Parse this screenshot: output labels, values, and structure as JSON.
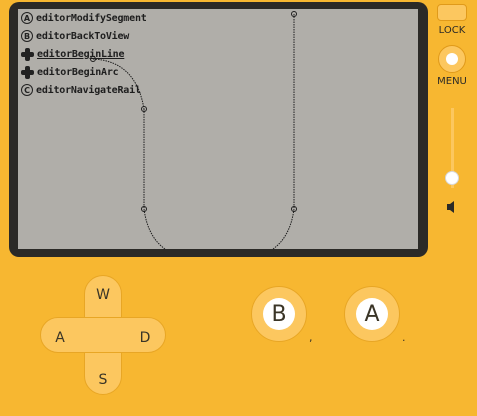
{
  "menu": {
    "items": [
      {
        "glyph": "A",
        "icon": "a-button-icon",
        "label": "editorModifySegment"
      },
      {
        "glyph": "B",
        "icon": "b-button-icon",
        "label": "editorBackToView"
      },
      {
        "glyph": "",
        "icon": "dpad-icon",
        "label": "editorBeginLine"
      },
      {
        "glyph": "",
        "icon": "dpad-icon",
        "label": "editorBeginArc"
      },
      {
        "glyph": "C",
        "icon": "crank-icon",
        "label": "editorNavigateRail"
      }
    ]
  },
  "side": {
    "lock_label": "LOCK",
    "menu_label": "MENU",
    "crank_level": 0.88
  },
  "dpad": {
    "up": "W",
    "left": "A",
    "right": "D",
    "down": "S"
  },
  "buttons": {
    "b_label": "B",
    "b_key": ",",
    "a_label": "A",
    "a_key": "."
  },
  "colors": {
    "body": "#f7b731",
    "screen": "#b0aea9",
    "bezel": "#2b2a27"
  }
}
